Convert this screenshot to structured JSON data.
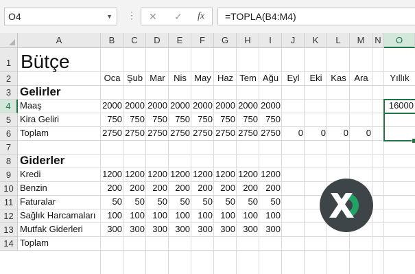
{
  "formula_bar": {
    "name_box": "O4",
    "cancel_glyph": "✕",
    "enter_glyph": "✓",
    "fx_glyph": "fx",
    "formula": "=TOPLA(B4:M4)"
  },
  "columns": [
    "A",
    "B",
    "C",
    "D",
    "E",
    "F",
    "G",
    "H",
    "I",
    "J",
    "K",
    "L",
    "M",
    "N",
    "O"
  ],
  "rows": [
    "1",
    "2",
    "3",
    "4",
    "5",
    "6",
    "7",
    "8",
    "9",
    "10",
    "11",
    "12",
    "13",
    "14"
  ],
  "sheet": {
    "title": "Bütçe",
    "months": [
      "Oca",
      "Şub",
      "Mar",
      "Nis",
      "May",
      "Haz",
      "Tem",
      "Ağu",
      "Eyl",
      "Eki",
      "Kas",
      "Ara"
    ],
    "annual_header": "Yıllık",
    "income_header": "Gelirler",
    "income_rows": [
      {
        "label": "Maaş",
        "values": [
          "2000",
          "2000",
          "2000",
          "2000",
          "2000",
          "2000",
          "2000",
          "2000",
          "",
          "",
          "",
          ""
        ],
        "annual": "16000"
      },
      {
        "label": "Kira Geliri",
        "values": [
          "750",
          "750",
          "750",
          "750",
          "750",
          "750",
          "750",
          "750",
          "",
          "",
          "",
          ""
        ],
        "annual": ""
      },
      {
        "label": "Toplam",
        "values": [
          "2750",
          "2750",
          "2750",
          "2750",
          "2750",
          "2750",
          "2750",
          "2750",
          "0",
          "0",
          "0",
          "0"
        ],
        "annual": ""
      }
    ],
    "expense_header": "Giderler",
    "expense_rows": [
      {
        "label": "Kredi",
        "values": [
          "1200",
          "1200",
          "1200",
          "1200",
          "1200",
          "1200",
          "1200",
          "1200"
        ]
      },
      {
        "label": "Benzin",
        "values": [
          "200",
          "200",
          "200",
          "200",
          "200",
          "200",
          "200",
          "200"
        ]
      },
      {
        "label": "Faturalar",
        "values": [
          "50",
          "50",
          "50",
          "50",
          "50",
          "50",
          "50",
          "50"
        ]
      },
      {
        "label": "Sağlık Harcamaları",
        "values": [
          "100",
          "100",
          "100",
          "100",
          "100",
          "100",
          "100",
          "100"
        ]
      },
      {
        "label": "Mutfak Giderleri",
        "values": [
          "300",
          "300",
          "300",
          "300",
          "300",
          "300",
          "300",
          "300"
        ]
      },
      {
        "label": "Toplam",
        "values": [
          "",
          "",
          "",
          "",
          "",
          "",
          "",
          ""
        ]
      }
    ]
  },
  "colors": {
    "accent": "#217346",
    "logo_dark": "#3d4548",
    "logo_green": "#21a366"
  }
}
